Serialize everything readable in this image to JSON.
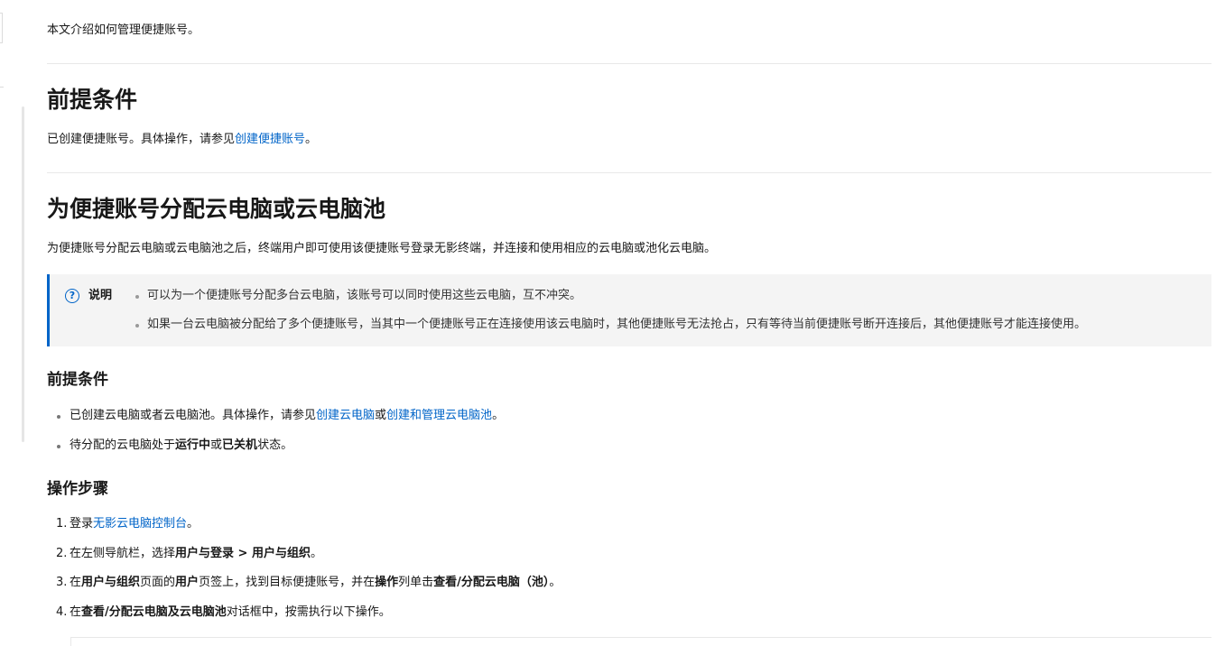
{
  "intro": "本文介绍如何管理便捷账号。",
  "section1": {
    "title": "前提条件",
    "text_before": "已创建便捷账号。具体操作，请参见",
    "link": "创建便捷账号",
    "text_after": "。"
  },
  "section2": {
    "title": "为便捷账号分配云电脑或云电脑池",
    "desc": "为便捷账号分配云电脑或云电脑池之后，终端用户即可使用该便捷账号登录无影终端，并连接和使用相应的云电脑或池化云电脑。",
    "note": {
      "icon": "question-circle-icon",
      "icon_glyph": "?",
      "label": "说明",
      "items": [
        "可以为一个便捷账号分配多台云电脑，该账号可以同时使用这些云电脑，互不冲突。",
        "如果一台云电脑被分配给了多个便捷账号，当其中一个便捷账号正在连接使用该云电脑时，其他便捷账号无法抢占，只有等待当前便捷账号断开连接后，其他便捷账号才能连接使用。"
      ]
    },
    "prereq": {
      "title": "前提条件",
      "item1": {
        "before": "已创建云电脑或者云电脑池。具体操作，请参见",
        "link1": "创建云电脑",
        "mid": "或",
        "link2": "创建和管理云电脑池",
        "after": "。"
      },
      "item2": {
        "before": "待分配的云电脑处于",
        "bold1": "运行中",
        "mid": "或",
        "bold2": "已关机",
        "after": "状态。"
      }
    },
    "steps": {
      "title": "操作步骤",
      "s1": {
        "num": "1.",
        "before": "登录",
        "link": "无影云电脑控制台",
        "after": "。"
      },
      "s2": {
        "num": "2.",
        "before": "在左侧导航栏，选择",
        "bold": "用户与登录 > 用户与组织",
        "after": "。"
      },
      "s3": {
        "num": "3.",
        "before": "在",
        "bold1": "用户与组织",
        "mid1": "页面的",
        "bold2": "用户",
        "mid2": "页签上，找到目标便捷账号，并在",
        "bold3": "操作",
        "mid3": "列单击",
        "bold4": "查看/分配云电脑（池）",
        "after": "。"
      },
      "s4": {
        "num": "4.",
        "before": "在",
        "bold": "查看/分配云电脑及云电脑池",
        "after": "对话框中，按需执行以下操作。"
      }
    }
  }
}
